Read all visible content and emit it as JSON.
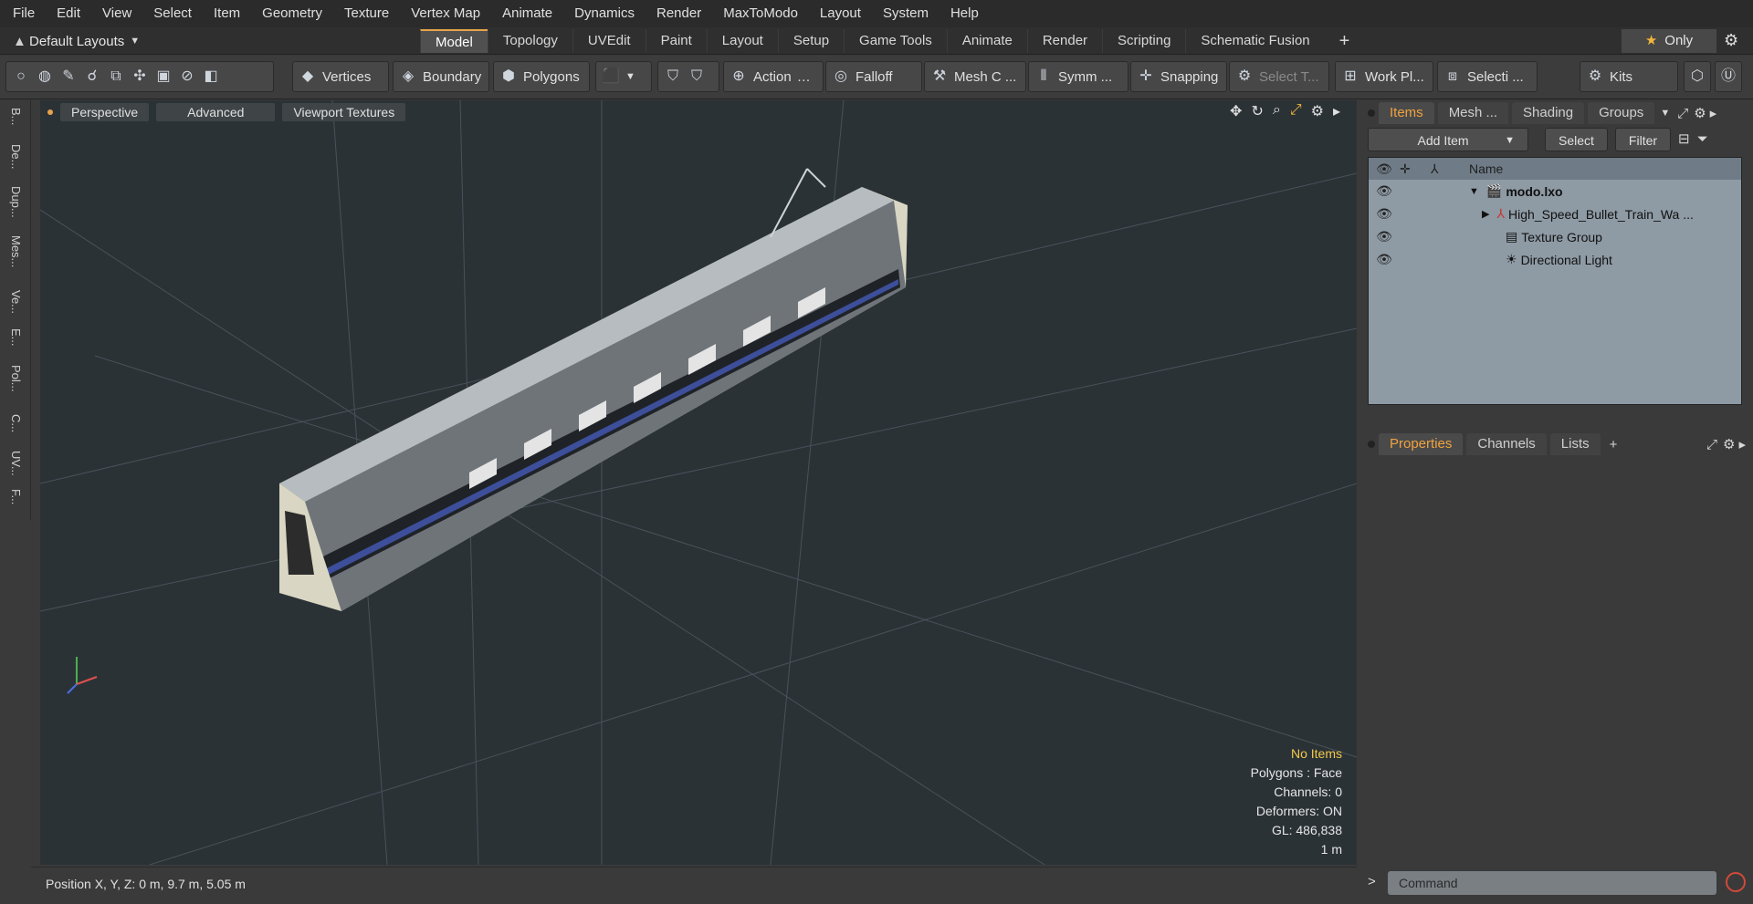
{
  "menu": [
    "File",
    "Edit",
    "View",
    "Select",
    "Item",
    "Geometry",
    "Texture",
    "Vertex Map",
    "Animate",
    "Dynamics",
    "Render",
    "MaxToModo",
    "Layout",
    "System",
    "Help"
  ],
  "layouts": {
    "label": "Default Layouts"
  },
  "tabs": [
    "Model",
    "Topology",
    "UVEdit",
    "Paint",
    "Layout",
    "Setup",
    "Game Tools",
    "Animate",
    "Render",
    "Scripting",
    "Schematic Fusion"
  ],
  "active_tab": "Model",
  "only_label": "Only",
  "toolbar": {
    "vertices": "Vertices",
    "boundary": "Boundary",
    "polygons": "Polygons",
    "action": "Action",
    "falloff": "Falloff",
    "mesh": "Mesh C ...",
    "symm": "Symm ...",
    "snapping": "Snapping",
    "select_t": "Select T...",
    "workplane": "Work Pl...",
    "selection": "Selecti ...",
    "kits": "Kits"
  },
  "left_tabs": [
    "B...",
    "De...",
    "Dup...",
    "Mes...",
    "Ve...",
    "E...",
    "Pol...",
    "C...",
    "UV...",
    "F..."
  ],
  "viewport": {
    "perspective": "Perspective",
    "advanced": "Advanced",
    "textures": "Viewport Textures",
    "info": {
      "no_items": "No Items",
      "polygons": "Polygons : Face",
      "channels": "Channels: 0",
      "deformers": "Deformers: ON",
      "gl": "GL: 486,838",
      "scale": "1 m"
    }
  },
  "status": {
    "position": "Position X, Y, Z:   0 m, 9.7 m, 5.05 m"
  },
  "right_tabs": [
    "Items",
    "Mesh ...",
    "Shading",
    "Groups"
  ],
  "item_tools": {
    "add": "Add Item",
    "select": "Select",
    "filter": "Filter"
  },
  "item_list": {
    "header": "Name",
    "rows": [
      {
        "name": "modo.lxo"
      },
      {
        "name": "High_Speed_Bullet_Train_Wa ..."
      },
      {
        "name": "Texture Group"
      },
      {
        "name": "Directional Light"
      }
    ]
  },
  "prop_tabs": [
    "Properties",
    "Channels",
    "Lists"
  ],
  "command": {
    "placeholder": "Command"
  }
}
